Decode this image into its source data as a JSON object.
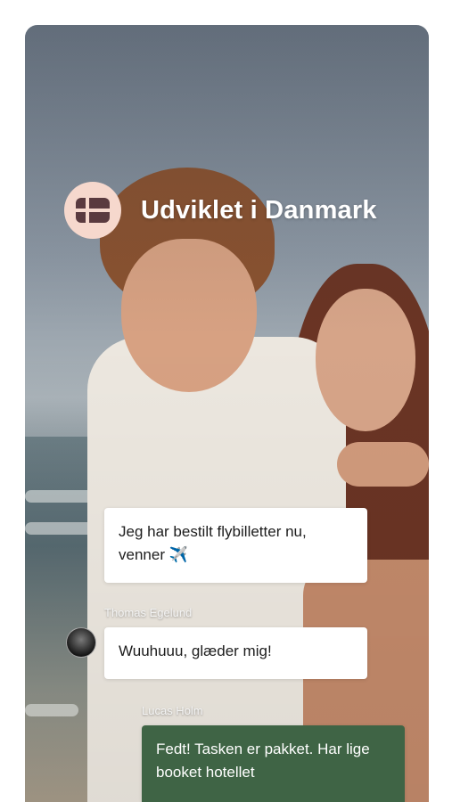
{
  "header": {
    "title": "Udviklet i Danmark",
    "icon": "danish-flag-icon"
  },
  "colors": {
    "badge_bg": "#f6d8cd",
    "flag": "#5a3a3f",
    "accent_bubble": "#3f6445"
  },
  "chat": {
    "messages": [
      {
        "text": "Jeg har bestilt flybilletter nu, venner ✈️"
      },
      {
        "sender": "Thomas Egelund",
        "text": "Wuuhuuu, glæder mig!"
      },
      {
        "sender": "Lucas Holm",
        "text": "Fedt! Tasken er pakket. Har lige booket hotellet"
      }
    ]
  }
}
